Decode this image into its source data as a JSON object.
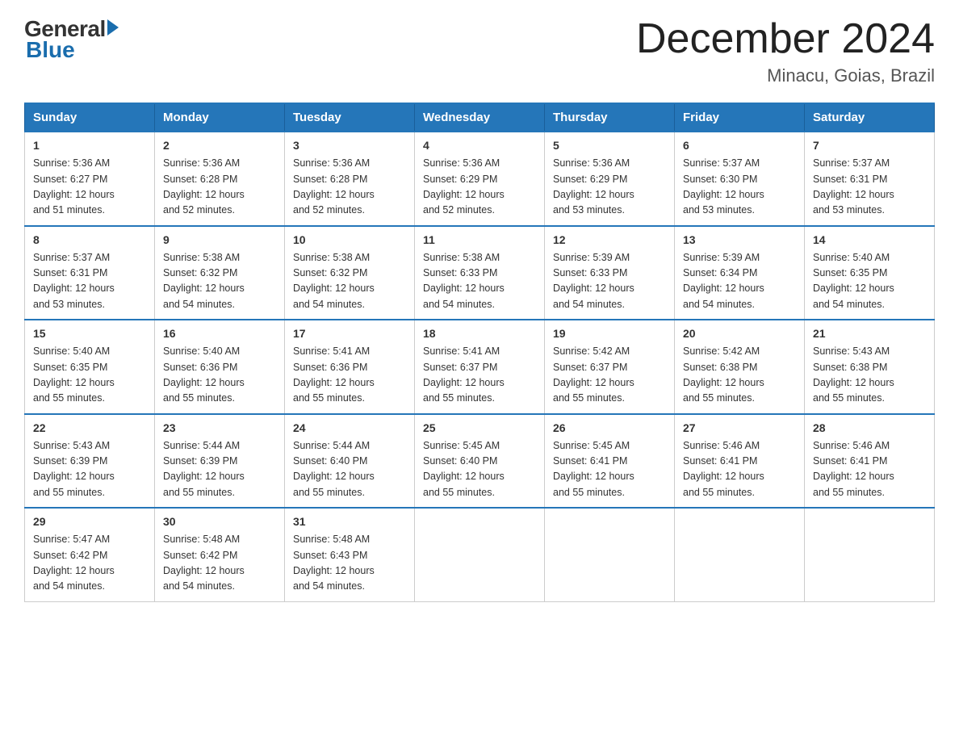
{
  "logo": {
    "general": "General",
    "blue": "Blue"
  },
  "title": "December 2024",
  "location": "Minacu, Goias, Brazil",
  "header_days": [
    "Sunday",
    "Monday",
    "Tuesday",
    "Wednesday",
    "Thursday",
    "Friday",
    "Saturday"
  ],
  "weeks": [
    [
      {
        "day": "1",
        "sunrise": "5:36 AM",
        "sunset": "6:27 PM",
        "daylight": "12 hours and 51 minutes."
      },
      {
        "day": "2",
        "sunrise": "5:36 AM",
        "sunset": "6:28 PM",
        "daylight": "12 hours and 52 minutes."
      },
      {
        "day": "3",
        "sunrise": "5:36 AM",
        "sunset": "6:28 PM",
        "daylight": "12 hours and 52 minutes."
      },
      {
        "day": "4",
        "sunrise": "5:36 AM",
        "sunset": "6:29 PM",
        "daylight": "12 hours and 52 minutes."
      },
      {
        "day": "5",
        "sunrise": "5:36 AM",
        "sunset": "6:29 PM",
        "daylight": "12 hours and 53 minutes."
      },
      {
        "day": "6",
        "sunrise": "5:37 AM",
        "sunset": "6:30 PM",
        "daylight": "12 hours and 53 minutes."
      },
      {
        "day": "7",
        "sunrise": "5:37 AM",
        "sunset": "6:31 PM",
        "daylight": "12 hours and 53 minutes."
      }
    ],
    [
      {
        "day": "8",
        "sunrise": "5:37 AM",
        "sunset": "6:31 PM",
        "daylight": "12 hours and 53 minutes."
      },
      {
        "day": "9",
        "sunrise": "5:38 AM",
        "sunset": "6:32 PM",
        "daylight": "12 hours and 54 minutes."
      },
      {
        "day": "10",
        "sunrise": "5:38 AM",
        "sunset": "6:32 PM",
        "daylight": "12 hours and 54 minutes."
      },
      {
        "day": "11",
        "sunrise": "5:38 AM",
        "sunset": "6:33 PM",
        "daylight": "12 hours and 54 minutes."
      },
      {
        "day": "12",
        "sunrise": "5:39 AM",
        "sunset": "6:33 PM",
        "daylight": "12 hours and 54 minutes."
      },
      {
        "day": "13",
        "sunrise": "5:39 AM",
        "sunset": "6:34 PM",
        "daylight": "12 hours and 54 minutes."
      },
      {
        "day": "14",
        "sunrise": "5:40 AM",
        "sunset": "6:35 PM",
        "daylight": "12 hours and 54 minutes."
      }
    ],
    [
      {
        "day": "15",
        "sunrise": "5:40 AM",
        "sunset": "6:35 PM",
        "daylight": "12 hours and 55 minutes."
      },
      {
        "day": "16",
        "sunrise": "5:40 AM",
        "sunset": "6:36 PM",
        "daylight": "12 hours and 55 minutes."
      },
      {
        "day": "17",
        "sunrise": "5:41 AM",
        "sunset": "6:36 PM",
        "daylight": "12 hours and 55 minutes."
      },
      {
        "day": "18",
        "sunrise": "5:41 AM",
        "sunset": "6:37 PM",
        "daylight": "12 hours and 55 minutes."
      },
      {
        "day": "19",
        "sunrise": "5:42 AM",
        "sunset": "6:37 PM",
        "daylight": "12 hours and 55 minutes."
      },
      {
        "day": "20",
        "sunrise": "5:42 AM",
        "sunset": "6:38 PM",
        "daylight": "12 hours and 55 minutes."
      },
      {
        "day": "21",
        "sunrise": "5:43 AM",
        "sunset": "6:38 PM",
        "daylight": "12 hours and 55 minutes."
      }
    ],
    [
      {
        "day": "22",
        "sunrise": "5:43 AM",
        "sunset": "6:39 PM",
        "daylight": "12 hours and 55 minutes."
      },
      {
        "day": "23",
        "sunrise": "5:44 AM",
        "sunset": "6:39 PM",
        "daylight": "12 hours and 55 minutes."
      },
      {
        "day": "24",
        "sunrise": "5:44 AM",
        "sunset": "6:40 PM",
        "daylight": "12 hours and 55 minutes."
      },
      {
        "day": "25",
        "sunrise": "5:45 AM",
        "sunset": "6:40 PM",
        "daylight": "12 hours and 55 minutes."
      },
      {
        "day": "26",
        "sunrise": "5:45 AM",
        "sunset": "6:41 PM",
        "daylight": "12 hours and 55 minutes."
      },
      {
        "day": "27",
        "sunrise": "5:46 AM",
        "sunset": "6:41 PM",
        "daylight": "12 hours and 55 minutes."
      },
      {
        "day": "28",
        "sunrise": "5:46 AM",
        "sunset": "6:41 PM",
        "daylight": "12 hours and 55 minutes."
      }
    ],
    [
      {
        "day": "29",
        "sunrise": "5:47 AM",
        "sunset": "6:42 PM",
        "daylight": "12 hours and 54 minutes."
      },
      {
        "day": "30",
        "sunrise": "5:48 AM",
        "sunset": "6:42 PM",
        "daylight": "12 hours and 54 minutes."
      },
      {
        "day": "31",
        "sunrise": "5:48 AM",
        "sunset": "6:43 PM",
        "daylight": "12 hours and 54 minutes."
      },
      null,
      null,
      null,
      null
    ]
  ],
  "labels": {
    "sunrise": "Sunrise:",
    "sunset": "Sunset:",
    "daylight": "Daylight:"
  }
}
